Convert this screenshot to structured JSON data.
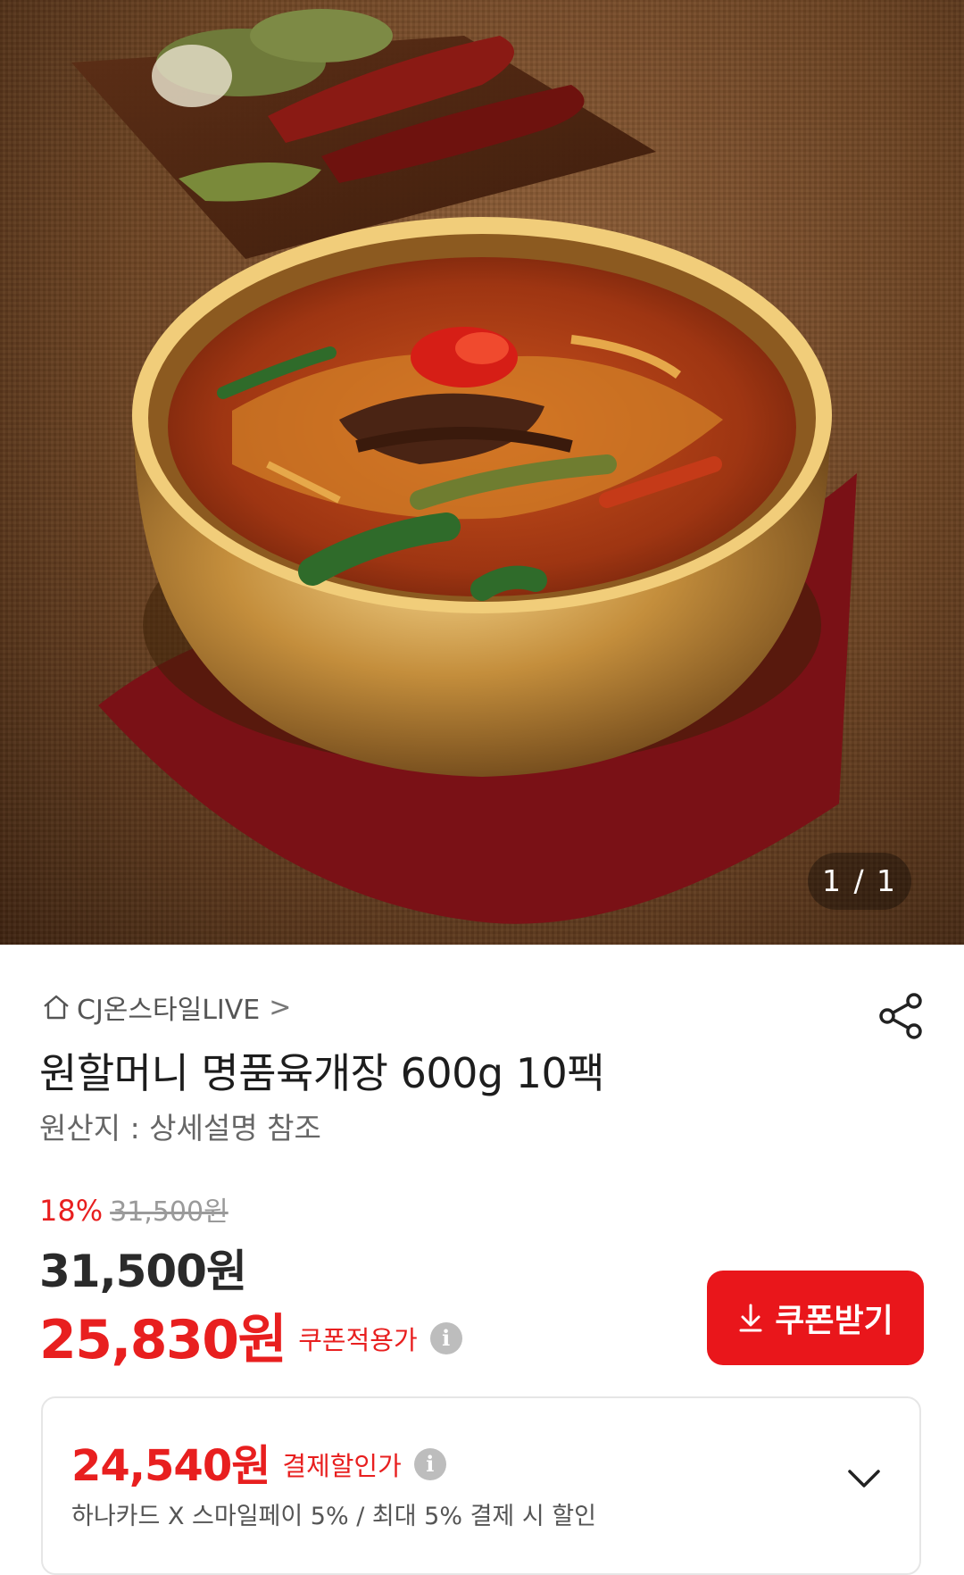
{
  "hero": {
    "image_alt": "육개장 상품 이미지",
    "counter": "1 / 1"
  },
  "seller": {
    "icon": "home-icon",
    "name": "CJ온스타일LIVE",
    "chevron": ">"
  },
  "share_icon": "share-icon",
  "product": {
    "title": "원할머니 명품육개장 600g 10팩",
    "origin": "원산지 : 상세설명 참조"
  },
  "price": {
    "discount_rate": "18%",
    "original_price": "31,500원",
    "sale_price": "31,500원",
    "coupon_price": "25,830원",
    "coupon_label": "쿠폰적용가",
    "info_icon": "i"
  },
  "coupon_button": {
    "icon": "download-icon",
    "label": "쿠폰받기"
  },
  "payment": {
    "price": "24,540원",
    "label": "결제할인가",
    "info_icon": "i",
    "description": "하나카드 X 스마일페이 5%  / 최대 5% 결제 시 할인",
    "expand_icon": "chevron-down-icon"
  },
  "colors": {
    "accent_red": "#e81f1f",
    "button_red": "#e9161b"
  }
}
